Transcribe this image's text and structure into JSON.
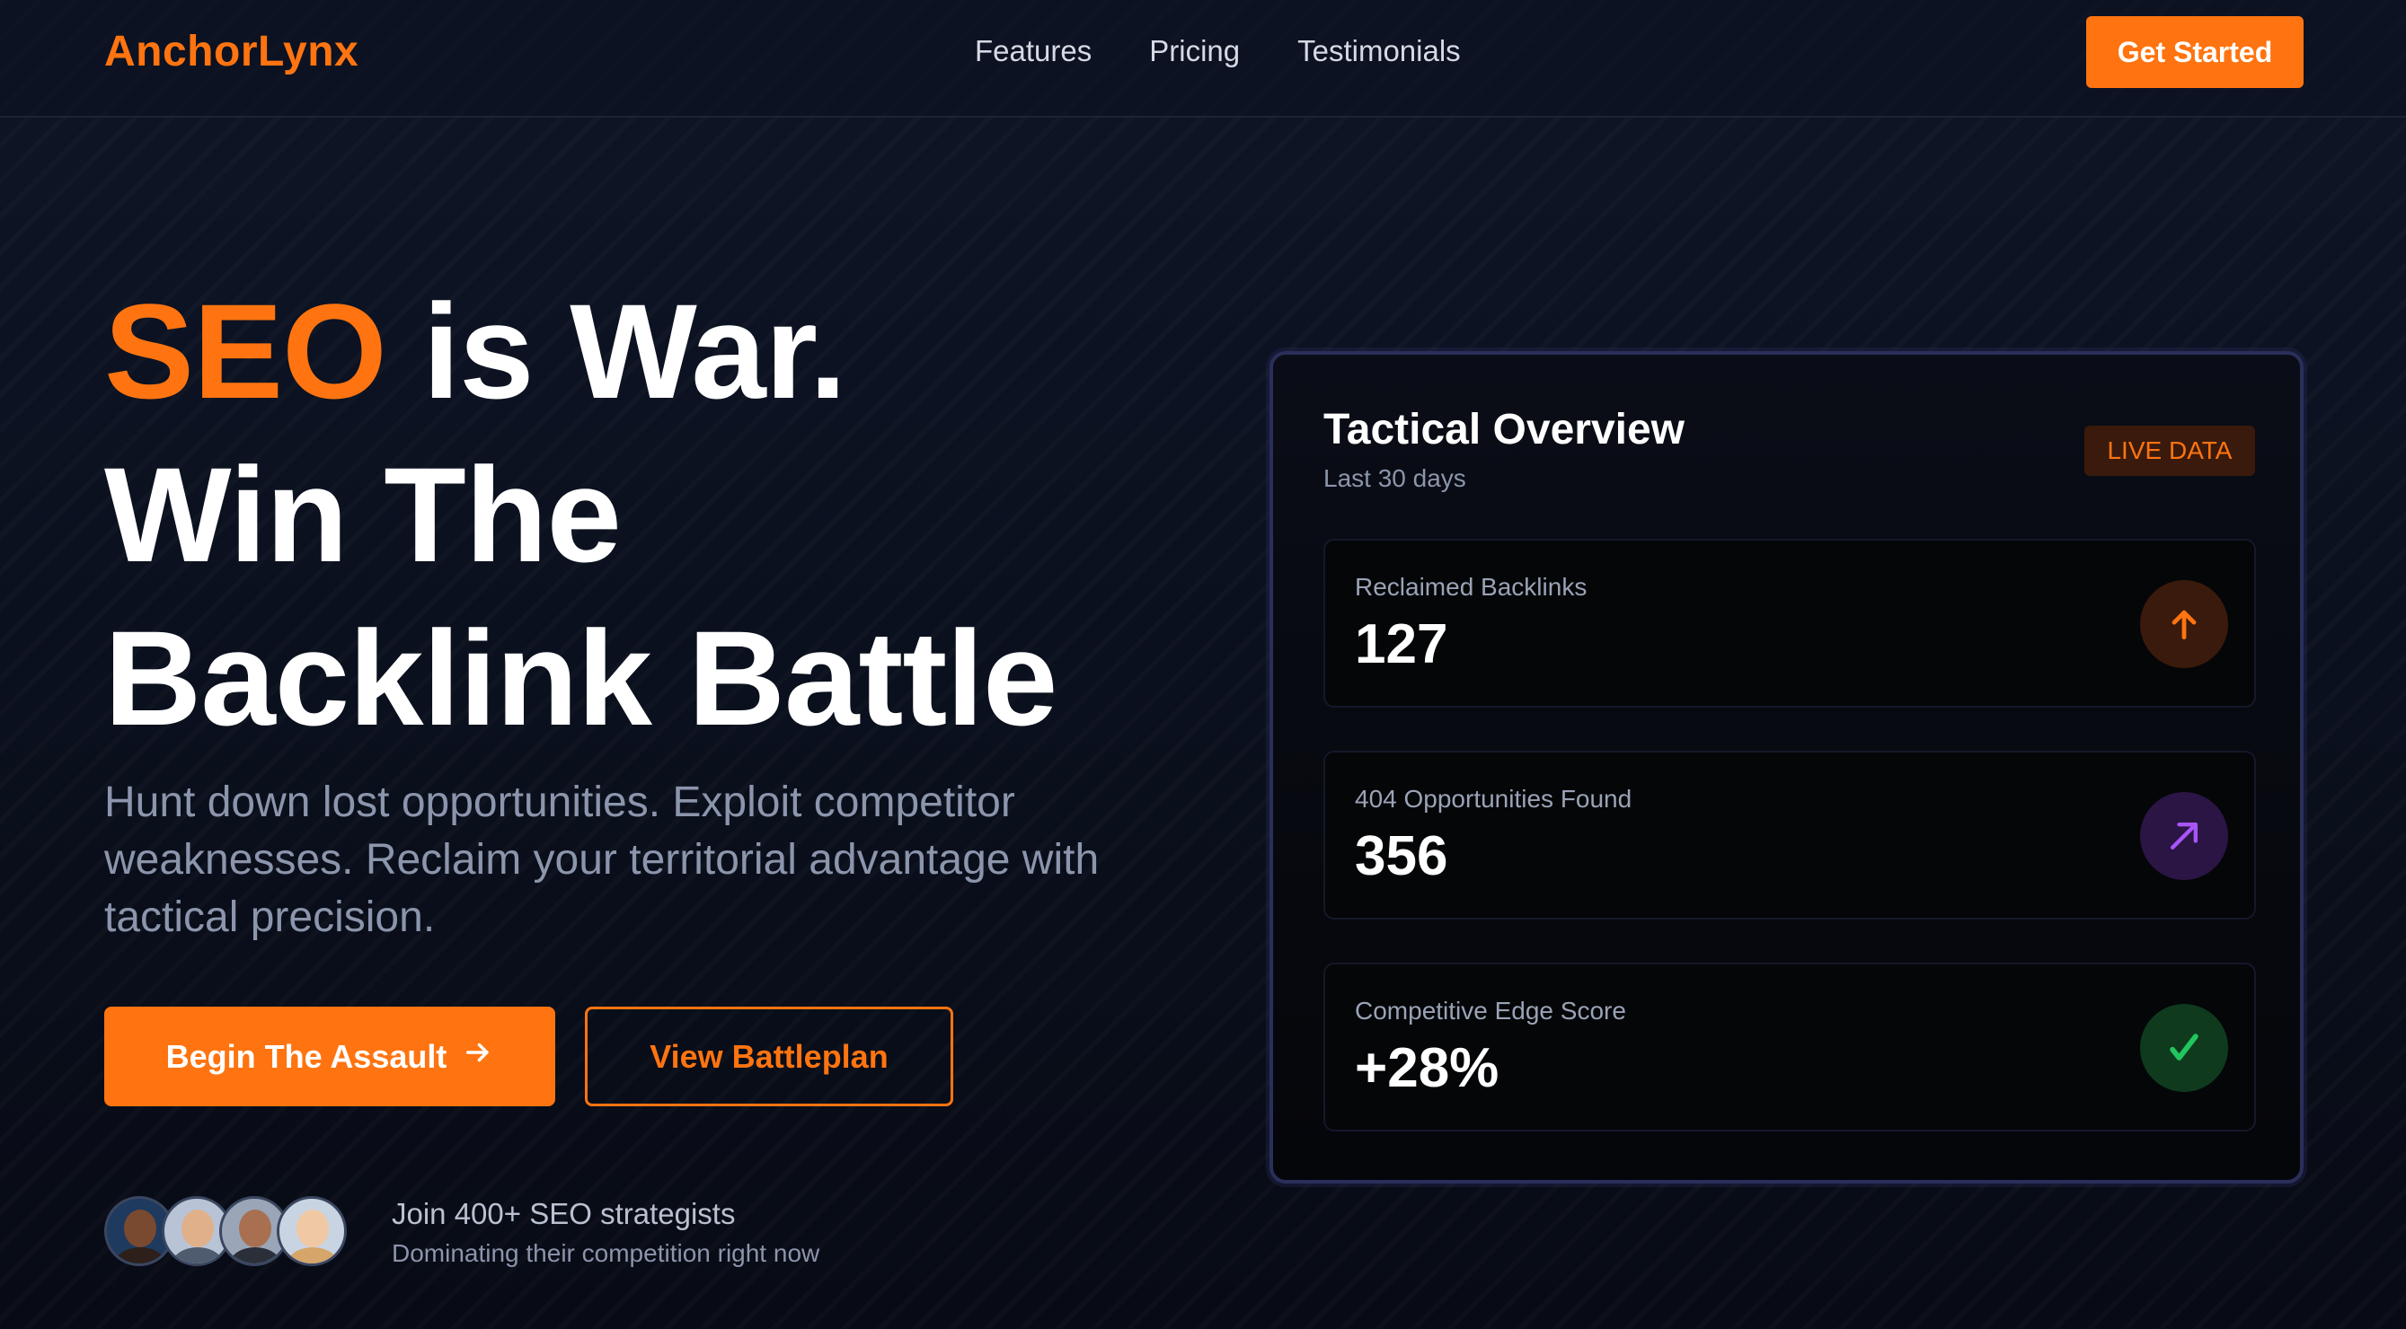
{
  "nav": {
    "logo": "AnchorLynx",
    "links": [
      "Features",
      "Pricing",
      "Testimonials"
    ],
    "cta": "Get Started"
  },
  "hero": {
    "headline_accent": "SEO",
    "headline_line1_rest": " is War.",
    "headline_line2": "Win The",
    "headline_line3": "Backlink Battle",
    "subhead": "Hunt down lost opportunities. Exploit competitor weaknesses. Reclaim your territorial advantage with tactical precision.",
    "primary_button": "Begin The Assault",
    "primary_button_icon": "arrow-right-icon",
    "secondary_button": "View Battleplan",
    "social_proof_line1": "Join 400+ SEO strategists",
    "social_proof_line2": "Dominating their competition right now",
    "avatar_count": 4
  },
  "card": {
    "title": "Tactical Overview",
    "subtitle": "Last 30 days",
    "badge": "LIVE DATA",
    "metrics": [
      {
        "label": "Reclaimed Backlinks",
        "value": "127",
        "icon": "arrow-up-icon",
        "icon_color": "#ff7410",
        "icon_bg": "#3a1a0c"
      },
      {
        "label": "404 Opportunities Found",
        "value": "356",
        "icon": "arrow-diagonal-icon",
        "icon_color": "#a855f7",
        "icon_bg": "#2a1545"
      },
      {
        "label": "Competitive Edge Score",
        "value": "+28%",
        "icon": "check-icon",
        "icon_color": "#22c55e",
        "icon_bg": "#0f3a1e"
      }
    ]
  },
  "colors": {
    "accent": "#ff7410",
    "background": "#0c1120",
    "muted_text": "#8b95ab"
  }
}
